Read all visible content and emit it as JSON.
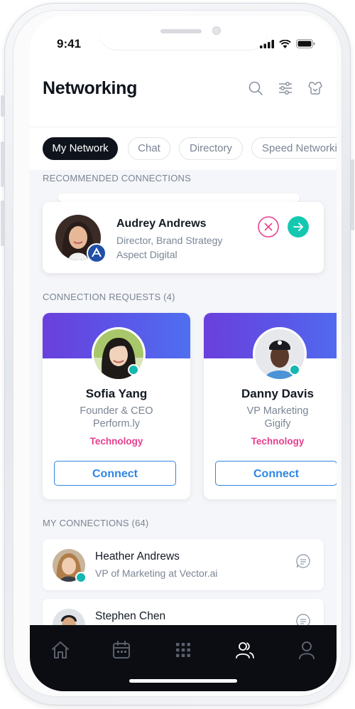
{
  "status_bar": {
    "time": "9:41"
  },
  "header": {
    "title": "Networking",
    "icons": [
      "search-icon",
      "filter-sliders-icon",
      "badge-icon"
    ]
  },
  "tabs": [
    {
      "label": "My Network",
      "active": true
    },
    {
      "label": "Chat",
      "active": false
    },
    {
      "label": "Directory",
      "active": false
    },
    {
      "label": "Speed Networking",
      "active": false
    }
  ],
  "recommended": {
    "heading": "RECOMMENDED CONNECTIONS",
    "person": {
      "name": "Audrey Andrews",
      "title": "Director, Brand Strategy",
      "company": "Aspect Digital"
    }
  },
  "requests": {
    "heading": "CONNECTION REQUESTS (4)",
    "items": [
      {
        "name": "Sofia Yang",
        "role": "Founder & CEO",
        "company": "Perform.ly",
        "tag": "Technology",
        "action": "Connect"
      },
      {
        "name": "Danny Davis",
        "role": "VP Marketing",
        "company": "Gigify",
        "tag": "Technology",
        "action": "Connect"
      }
    ]
  },
  "connections": {
    "heading": "MY CONNECTIONS (64)",
    "items": [
      {
        "name": "Heather Andrews",
        "subtitle": "VP of Marketing at Vector.ai"
      },
      {
        "name": "Stephen Chen",
        "subtitle": ""
      }
    ]
  },
  "tab_bar": {
    "items": [
      "home-icon",
      "calendar-icon",
      "grid-icon",
      "people-icon",
      "profile-icon"
    ],
    "active": "people-icon"
  },
  "colors": {
    "accent_pink": "#e83e8c",
    "accent_teal": "#14c8b0",
    "connect_blue": "#2f86e6",
    "banner_purple": "#6a3fdc",
    "tabbar_bg": "#0b0d12"
  }
}
